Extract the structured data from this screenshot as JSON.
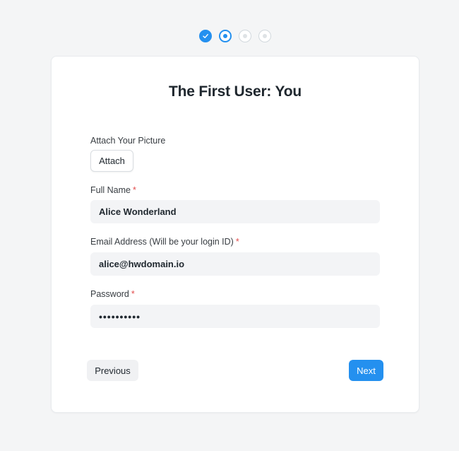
{
  "steps": [
    {
      "state": "done",
      "icon": "check-icon"
    },
    {
      "state": "active",
      "icon": "dot-icon"
    },
    {
      "state": "pending",
      "icon": "dot-icon"
    },
    {
      "state": "pending",
      "icon": "dot-icon"
    }
  ],
  "form": {
    "title": "The First User: You",
    "picture_label": "Attach Your Picture",
    "attach_label": "Attach",
    "full_name_label": "Full Name",
    "full_name_value": "Alice Wonderland",
    "email_label": "Email Address (Will be your login ID)",
    "email_value": "alice@hwdomain.io",
    "password_label": "Password",
    "password_value": "••••••••••",
    "required_mark": "*"
  },
  "nav": {
    "previous_label": "Previous",
    "next_label": "Next"
  },
  "colors": {
    "primary": "#2490ef",
    "required": "#e24c4c",
    "input_bg": "#f3f4f6"
  }
}
